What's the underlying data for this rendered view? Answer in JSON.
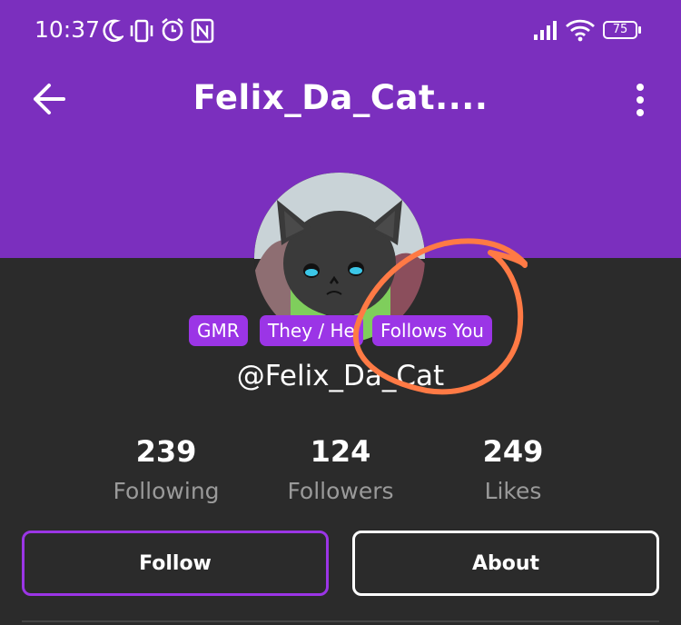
{
  "status_bar": {
    "time": "10:37",
    "battery": "75",
    "icons": [
      "moon-icon",
      "vibrate-icon",
      "alarm-icon",
      "nfc-icon",
      "signal-icon",
      "wifi-icon",
      "battery-icon"
    ]
  },
  "app_bar": {
    "title": "Felix_Da_Cat....",
    "back_icon": "arrow-left-icon",
    "more_icon": "more-vertical-icon"
  },
  "profile": {
    "badges": [
      "GMR",
      "They / He",
      "Follows You"
    ],
    "handle": "@Felix_Da_Cat"
  },
  "stats": [
    {
      "value": "239",
      "label": "Following"
    },
    {
      "value": "124",
      "label": "Followers"
    },
    {
      "value": "249",
      "label": "Likes"
    }
  ],
  "actions": {
    "follow_label": "Follow",
    "about_label": "About"
  },
  "colors": {
    "header": "#7b2fbe",
    "background": "#2b2b2b",
    "badge": "#9b35e6",
    "annotation": "#ff7a45"
  }
}
